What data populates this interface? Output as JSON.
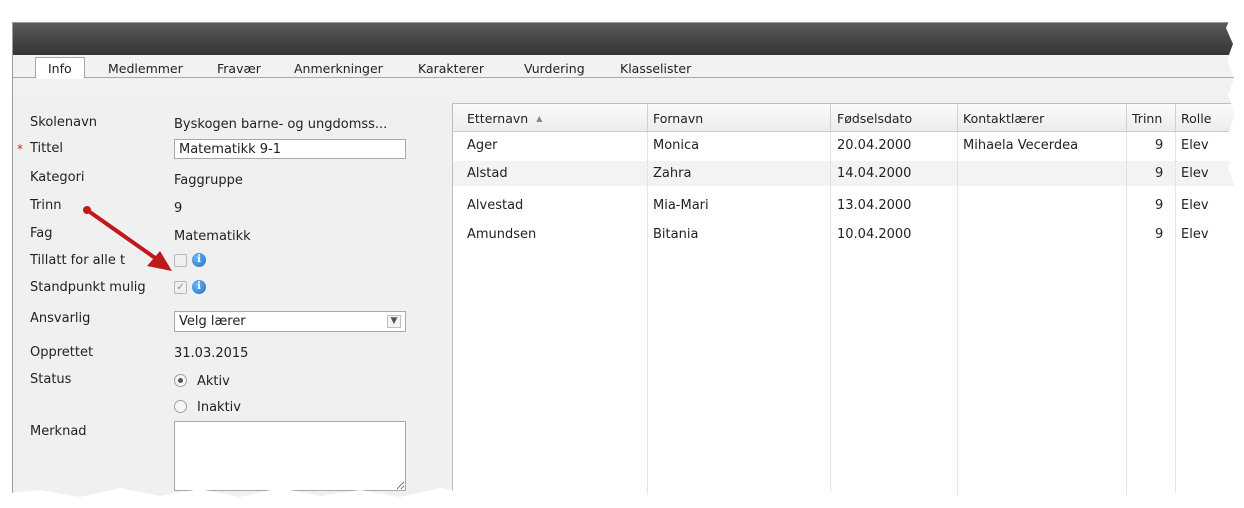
{
  "tabs": [
    {
      "label": "Info",
      "active": true
    },
    {
      "label": "Medlemmer"
    },
    {
      "label": "Fravær"
    },
    {
      "label": "Anmerkninger"
    },
    {
      "label": "Karakterer"
    },
    {
      "label": "Vurdering"
    },
    {
      "label": "Klasselister"
    }
  ],
  "form": {
    "skolenavn_label": "Skolenavn",
    "skolenavn_value": "Byskogen barne- og ungdomss...",
    "required_mark": "*",
    "tittel_label": "Tittel",
    "tittel_value": "Matematikk 9-1",
    "kategori_label": "Kategori",
    "kategori_value": "Faggruppe",
    "trinn_label": "Trinn",
    "trinn_value": "9",
    "fag_label": "Fag",
    "fag_value": "Matematikk",
    "tillatt_label": "Tillatt for alle t",
    "standpunkt_label": "Standpunkt mulig",
    "ansvarlig_label": "Ansvarlig",
    "ansvarlig_value": "Velg lærer",
    "opprettet_label": "Opprettet",
    "opprettet_value": "31.03.2015",
    "status_label": "Status",
    "status_aktiv": "Aktiv",
    "status_inaktiv": "Inaktiv",
    "merknad_label": "Merknad",
    "info_glyph": "i"
  },
  "grid": {
    "columns": [
      "Etternavn",
      "Fornavn",
      "Fødselsdato",
      "Kontaktlærer",
      "Trinn",
      "Rolle"
    ],
    "sort_glyph": "▲",
    "rows": [
      [
        "Ager",
        "Monica",
        "20.04.2000",
        "Mihaela Vecerdea",
        "9",
        "Elev"
      ],
      [
        "Alstad",
        "Zahra",
        "14.04.2000",
        "",
        "9",
        "Elev"
      ],
      [
        "Alvestad",
        "Mia-Mari",
        "13.04.2000",
        "",
        "9",
        "Elev"
      ],
      [
        "Amundsen",
        "Bitania",
        "10.04.2000",
        "",
        "9",
        "Elev"
      ]
    ]
  },
  "icons": {
    "select_chevron": "chevron-down-icon",
    "info": "info-icon",
    "annotation": "red-arrow-icon"
  },
  "colors": {
    "titlebar": "#3d3d3d",
    "required": "#dd2222",
    "annotation_arrow": "#c0191b",
    "info_icon": "#1c6fc4"
  }
}
